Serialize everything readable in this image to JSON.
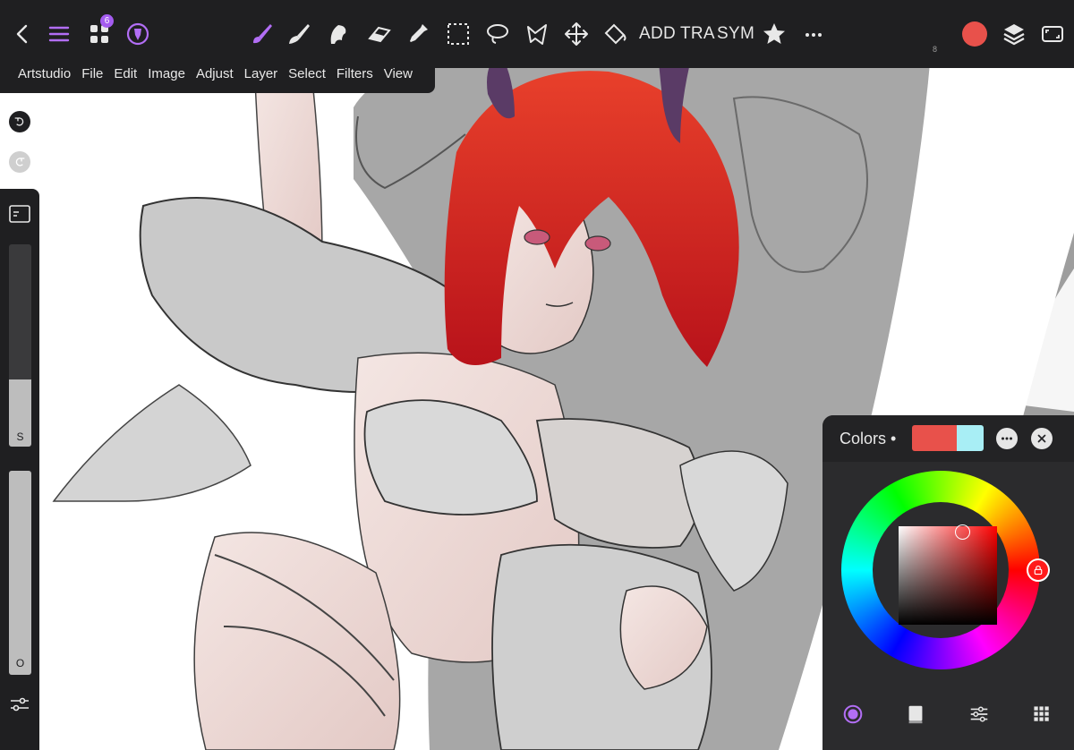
{
  "app": {
    "name": "Artstudio",
    "layers_badge": "6",
    "tiny_mark": "8"
  },
  "toolbar": {
    "left": [
      "back-icon",
      "menu-icon",
      "gallery-icon",
      "brush-settings-icon"
    ],
    "tools": [
      "paint-brush-icon",
      "smudge-icon",
      "blend-icon",
      "eraser-icon",
      "eyedropper-icon",
      "rect-select-icon",
      "lasso-select-icon",
      "magic-wand-icon",
      "move-icon",
      "fill-icon"
    ],
    "add_label": "ADD",
    "transform_label": "TRA",
    "symmetry_label": "SYM",
    "right": [
      "favorite-icon",
      "more-icon",
      "color-swatch",
      "layers-icon",
      "fullscreen-icon"
    ],
    "current_color": "#e8514b",
    "active_tool_color": "#b26ef5"
  },
  "menu": {
    "items": [
      "Artstudio",
      "File",
      "Edit",
      "Image",
      "Adjust",
      "Layer",
      "Select",
      "Filters",
      "View"
    ]
  },
  "left_panel": {
    "size_label": "S",
    "size_value": 0.33,
    "opacity_label": "O",
    "opacity_value": 1.0
  },
  "colors_panel": {
    "title": "Colors",
    "bullet": "•",
    "primary_color": "#e8514b",
    "secondary_color": "#a8eef5",
    "tabs": [
      "wheel-tab-icon",
      "palette-tab-icon",
      "sliders-tab-icon",
      "swatches-tab-icon"
    ],
    "active_tab": "wheel-tab-icon",
    "hue_accent": "#b26ef5"
  }
}
